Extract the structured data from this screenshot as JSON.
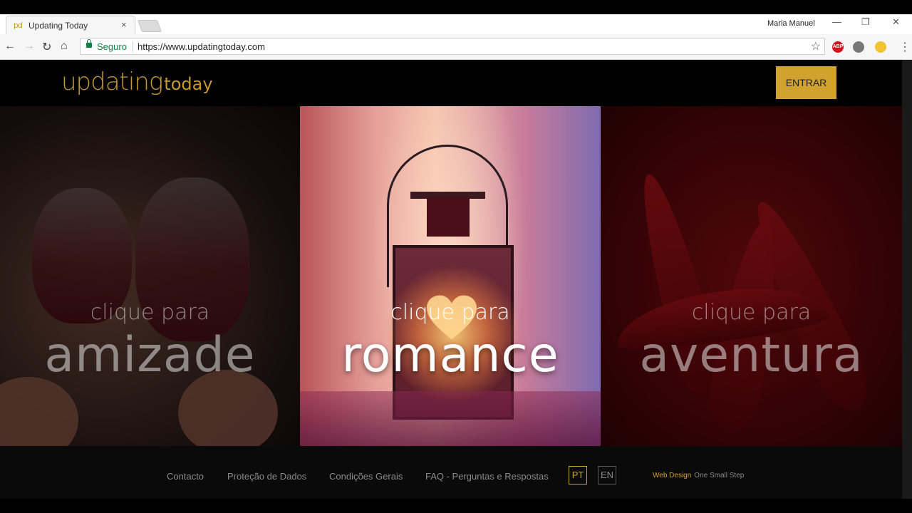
{
  "browser": {
    "tab_favicon": "pd",
    "tab_title": "Updating Today",
    "tab_close": "×",
    "profile_name": "Maria Manuel",
    "secure_label": "Seguro",
    "url": "https://www.updatingtoday.com",
    "icons": [
      "back-icon",
      "forward-icon",
      "reload-icon",
      "home-icon",
      "lock-icon",
      "star-icon",
      "adblock-icon",
      "extension-icon",
      "moon-icon",
      "menu-icon"
    ],
    "ext_adblock_label": "ABP"
  },
  "site": {
    "logo_main": "updating",
    "logo_sub": "today",
    "enter_label": "ENTRAR",
    "accent_color": "#d1a22d",
    "panels": [
      {
        "small": "clique para",
        "big": "amizade"
      },
      {
        "small": "clique para",
        "big": "romance"
      },
      {
        "small": "clique para",
        "big": "aventura"
      }
    ],
    "footer": {
      "links": [
        "Contacto",
        "Proteção de Dados",
        "Condições Gerais",
        "FAQ - Perguntas e Respostas"
      ],
      "lang_pt": "PT",
      "lang_en": "EN",
      "credit_a": "Web Design",
      "credit_b": "One Small Step"
    }
  }
}
